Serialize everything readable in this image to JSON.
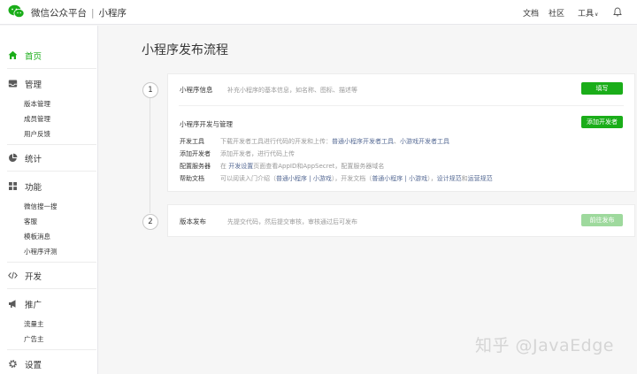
{
  "header": {
    "brand_title": "微信公众平台",
    "separator": "|",
    "product": "小程序",
    "nav": [
      "文档",
      "社区",
      "工具"
    ],
    "tools_caret": "∨"
  },
  "sidebar": {
    "home": "首页",
    "manage": {
      "label": "管理",
      "items": [
        "版本管理",
        "成员管理",
        "用户反馈"
      ]
    },
    "stats": "统计",
    "features": {
      "label": "功能",
      "items": [
        "微信搜一搜",
        "客服",
        "模板消息",
        "小程序评测"
      ]
    },
    "dev": "开发",
    "promo": {
      "label": "推广",
      "items": [
        "流量主",
        "广告主"
      ]
    },
    "settings": "设置"
  },
  "main": {
    "title": "小程序发布流程",
    "steps": [
      {
        "number": "1",
        "info": {
          "title": "小程序信息",
          "desc": "补充小程序的基本信息，如名称、图标、描述等",
          "button": "填写"
        },
        "dev": {
          "title": "小程序开发与管理",
          "button": "添加开发者",
          "rows": [
            {
              "key": "开发工具",
              "pre": "下载开发者工具进行代码的开发和上传：",
              "link1": "普通小程序开发者工具",
              "mid": "、",
              "link2": "小游戏开发者工具"
            },
            {
              "key": "添加开发者",
              "text": "添加开发者，进行代码上传"
            },
            {
              "key": "配置服务器",
              "pre": "在 ",
              "em": "开发设置",
              "post": "页面查看AppID和AppSecret，配置服务器域名"
            },
            {
              "key": "帮助文档",
              "pre": "可以阅读入门介绍（",
              "link1": "普通小程序 | 小游戏",
              "mid": "），开发文档（",
              "link2": "普通小程序 | 小游戏",
              "mid2": "），",
              "link3": "设计规范",
              "and": "和",
              "link4": "运营规范"
            }
          ]
        }
      },
      {
        "number": "2",
        "title": "版本发布",
        "desc": "先提交代码，然后提交审核，审核通过后可发布",
        "button": "前往发布"
      }
    ]
  },
  "watermark": "知乎 @JavaEdge",
  "colors": {
    "accent": "#1aad19",
    "link": "#576b95",
    "muted": "#9a9a9a"
  }
}
